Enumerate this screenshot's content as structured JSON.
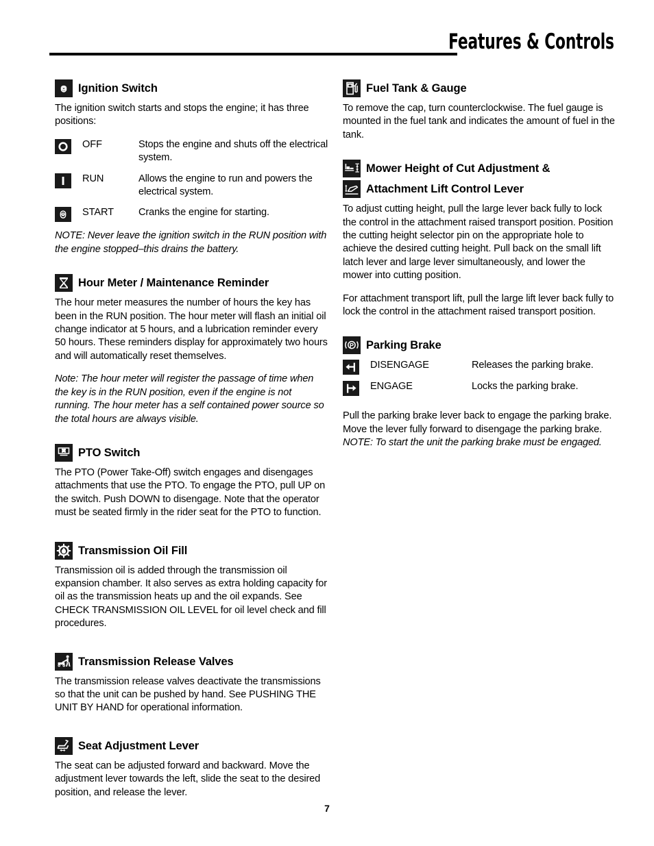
{
  "header": {
    "title": "Features & Controls"
  },
  "footer": {
    "page_number": "7"
  },
  "left_column": {
    "ignition": {
      "icon": "ignition-key-icon",
      "title": "Ignition Switch",
      "intro": "The ignition switch starts and stops the engine; it has three positions:",
      "positions": [
        {
          "icon": "circle-off-icon",
          "term": "OFF",
          "desc": "Stops the engine and shuts off the electrical system."
        },
        {
          "icon": "bar-run-icon",
          "term": "RUN",
          "desc": "Allows the engine to run and powers the electrical system."
        },
        {
          "icon": "key-start-icon",
          "term": "START",
          "desc": "Cranks the engine for starting."
        }
      ],
      "note": "NOTE: Never leave the ignition switch in the RUN position with the engine stopped–this drains the battery."
    },
    "hour_meter": {
      "icon": "hourglass-icon",
      "title": "Hour Meter / Maintenance Reminder",
      "paragraph1": "The hour meter measures the number of hours the key has been in the RUN position.  The hour meter will flash an initial oil change indicator at 5 hours, and a lubrication reminder every 50 hours.  These reminders display for approximately two hours and will automatically reset themselves.",
      "paragraph2": "Note: The hour meter will register the passage of time when the key is in the RUN position, even if the engine is not running.  The hour meter has a self contained power source so the total hours are always visible."
    },
    "pto": {
      "icon": "pto-switch-icon",
      "title": "PTO Switch",
      "paragraph1": "The PTO (Power Take-Off) switch engages and disengages attachments that use the PTO. To engage the PTO, pull UP on the switch. Push DOWN to disengage. Note that the operator must be seated firmly in the rider seat for the PTO to function."
    },
    "transmission_oil_fill": {
      "icon": "gear-oil-drop-icon",
      "title": "Transmission Oil Fill",
      "paragraph1": "Transmission oil is added through the transmission oil expansion chamber.  It also serves as extra holding capacity for oil as the transmission heats up and the oil expands.  See CHECK TRANSMISSION OIL LEVEL for oil level check and fill procedures."
    },
    "transmission_release_valves": {
      "icon": "push-mower-icon",
      "title": "Transmission Release Valves",
      "paragraph1": "The transmission release valves deactivate the transmissions so that the unit can be pushed by hand.  See PUSHING THE UNIT BY HAND for operational information."
    },
    "seat_adjustment": {
      "icon": "seat-adjust-icon",
      "title": "Seat Adjustment Lever",
      "paragraph1": "The seat can be adjusted forward and backward.  Move the adjustment lever towards the left, slide the seat to the desired position, and release the lever."
    }
  },
  "right_column": {
    "fuel_tank": {
      "icon": "fuel-pump-icon",
      "title": "Fuel Tank & Gauge",
      "paragraph1": "To remove the cap, turn counterclockwise.  The fuel gauge is mounted in the fuel tank and indicates the amount of fuel in the tank."
    },
    "mower_height": {
      "icon1": "mower-height-icon",
      "title1": "Mower Height of Cut Adjustment &",
      "icon2": "attachment-lift-icon",
      "title2": "Attachment Lift Control Lever",
      "paragraph1": "To adjust cutting height, pull the large lever back fully to lock the control in the attachment raised transport position.  Position the cutting height selector pin on the appropriate hole to achieve the desired cutting height. Pull back on the small lift latch lever and large lever simultaneously, and lower the mower into cutting position.",
      "paragraph2": "For attachment transport lift, pull the large lift lever back fully to lock the control in the attachment raised transport position."
    },
    "parking_brake": {
      "icon": "parking-brake-icon",
      "title": "Parking Brake",
      "states": [
        {
          "icon": "arrow-left-disengage-icon",
          "term": "DISENGAGE",
          "desc": "Releases the parking brake."
        },
        {
          "icon": "arrow-right-engage-icon",
          "term": "ENGAGE",
          "desc": "Locks the parking brake."
        }
      ],
      "paragraph1_part1": "Pull the parking brake lever back to engage the parking brake.  Move the lever fully forward to disengage the parking brake.  ",
      "paragraph1_note": "NOTE: To start the unit the parking brake must be engaged."
    }
  }
}
